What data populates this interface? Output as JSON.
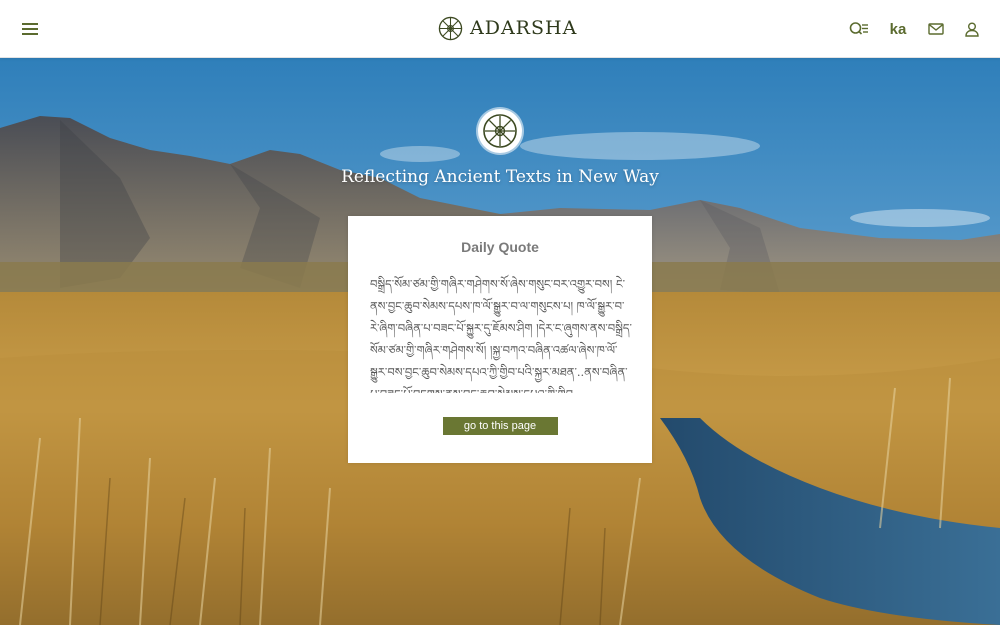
{
  "header": {
    "brand": "ADARSHA",
    "menu_icon": "hamburger-menu-icon",
    "actions": {
      "search_icon": "search-list-icon",
      "language_label": "ka",
      "mail_icon": "mail-icon",
      "user_icon": "user-icon"
    }
  },
  "hero": {
    "emblem_icon": "dharma-wheel-icon",
    "tagline": "Reflecting Ancient Texts in New Way"
  },
  "quote": {
    "title": "Daily Quote",
    "text": "བསྒྲིད་སོམ་ཙམ་གྱི་གཞིར་གཤེགས་སོ་ཞེས་གསུང་བར་འགྱུར་བས། ངེ་ནས་བྱང་ཆུབ་སེམས་དཔས་ཁ་ལོ་སྒྱུར་བ་ལ་གསུངས་པ། ཁ་ལོ་སྒྱུར་བ་རེ་ཞིག་བཞིན་པ་བཟང་པོ་སྐྱུར་དུ་ཇོམས་ཤིག །དེར་ང་ཞུགས་ནས་བསྒྲིད་སོམ་ཙམ་གྱི་གཞིར་གཤེགས་སོ། །སྐྱ་བཀའ་བཞིན་འཚལ་ཞེས་ཁ་ལོ་སྒྱུར་བས་བྱང་ཆུབ་སེམས་དཔའ་ཀྱི་གྱིབ་པའི་སྐྱར་མཐན་..ནས་བཞིན་པ་བཟང་པོ་བཏགས་ནས་བྱང་ཆུབ་སེམས་དཔའ་ཀྱི་གྱིབ",
    "button_label": "go to this page"
  },
  "colors": {
    "accent": "#6a7733",
    "icon": "#5b6b2f",
    "brand_text": "#2f3a1c"
  }
}
